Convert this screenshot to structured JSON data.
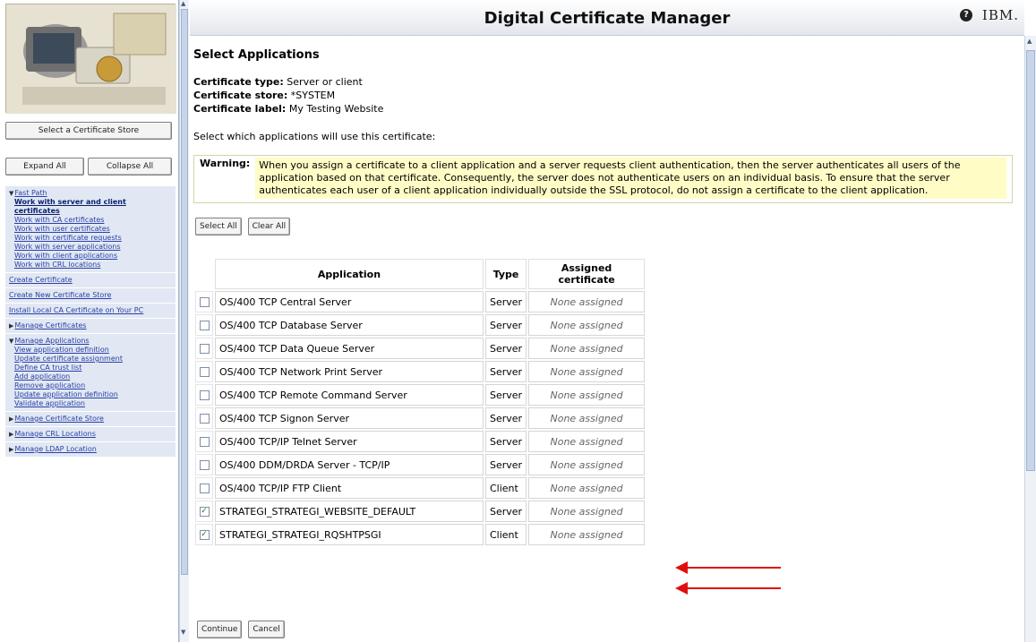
{
  "header": {
    "title": "Digital Certificate Manager",
    "help_icon": "question-circle-icon",
    "logo_text": "IBM."
  },
  "nav": {
    "image": "computer-with-certificate-illustration",
    "select_store_button": "Select a Certificate Store",
    "expand_all": "Expand All",
    "collapse_all": "Collapse All",
    "fast_path": {
      "label": "Fast Path",
      "items": [
        "Work with server and client certificates",
        "Work with CA certificates",
        "Work with user certificates",
        "Work with certificate requests",
        "Work with server applications",
        "Work with client applications",
        "Work with CRL locations"
      ]
    },
    "create_certificate": "Create Certificate",
    "create_new_store": "Create New Certificate Store",
    "install_local_ca": "Install Local CA Certificate on Your PC",
    "manage_certificates": "Manage Certificates",
    "manage_applications": {
      "label": "Manage Applications",
      "items": [
        "View application definition",
        "Update certificate assignment",
        "Define CA trust list",
        "Add application",
        "Remove application",
        "Update application definition",
        "Validate application"
      ]
    },
    "manage_certificate_store": "Manage Certificate Store",
    "manage_crl_locations": "Manage CRL Locations",
    "manage_ldap_location": "Manage LDAP Location"
  },
  "main": {
    "section_heading": "Select Applications",
    "cert_type_label": "Certificate type:",
    "cert_type_value": "Server or client",
    "cert_store_label": "Certificate store:",
    "cert_store_value": "*SYSTEM",
    "cert_label_label": "Certificate label:",
    "cert_label_value": "My Testing Website",
    "instruction": "Select which applications will use this certificate:",
    "warning_label": "Warning:",
    "warning_text": "When you assign a certificate to a client application and a server requests client authentication, then the server authenticates all users of the application based on that certificate. Consequently, the server does not authenticate users on an individual basis. To ensure that the server authenticates each user of a client application individually outside the SSL protocol, do not assign a certificate to the client application.",
    "select_all": "Select All",
    "clear_all": "Clear All",
    "table": {
      "headers": [
        "Application",
        "Type",
        "Assigned certificate"
      ],
      "rows": [
        {
          "checked": false,
          "application": "OS/400 TCP Central Server",
          "type": "Server",
          "assigned": "None assigned"
        },
        {
          "checked": false,
          "application": "OS/400 TCP Database Server",
          "type": "Server",
          "assigned": "None assigned"
        },
        {
          "checked": false,
          "application": "OS/400 TCP Data Queue Server",
          "type": "Server",
          "assigned": "None assigned"
        },
        {
          "checked": false,
          "application": "OS/400 TCP Network Print Server",
          "type": "Server",
          "assigned": "None assigned"
        },
        {
          "checked": false,
          "application": "OS/400 TCP Remote Command Server",
          "type": "Server",
          "assigned": "None assigned"
        },
        {
          "checked": false,
          "application": "OS/400 TCP Signon Server",
          "type": "Server",
          "assigned": "None assigned"
        },
        {
          "checked": false,
          "application": "OS/400 TCP/IP Telnet Server",
          "type": "Server",
          "assigned": "None assigned"
        },
        {
          "checked": false,
          "application": "OS/400 DDM/DRDA Server - TCP/IP",
          "type": "Server",
          "assigned": "None assigned"
        },
        {
          "checked": false,
          "application": "OS/400 TCP/IP FTP Client",
          "type": "Client",
          "assigned": "None assigned"
        },
        {
          "checked": true,
          "application": "STRATEGI_STRATEGI_WEBSITE_DEFAULT",
          "type": "Server",
          "assigned": "None assigned"
        },
        {
          "checked": true,
          "application": "STRATEGI_STRATEGI_RQSHTPSGI",
          "type": "Client",
          "assigned": "None assigned"
        }
      ]
    },
    "continue": "Continue",
    "cancel": "Cancel"
  },
  "annotations": {
    "arrow_color": "#e01010"
  }
}
